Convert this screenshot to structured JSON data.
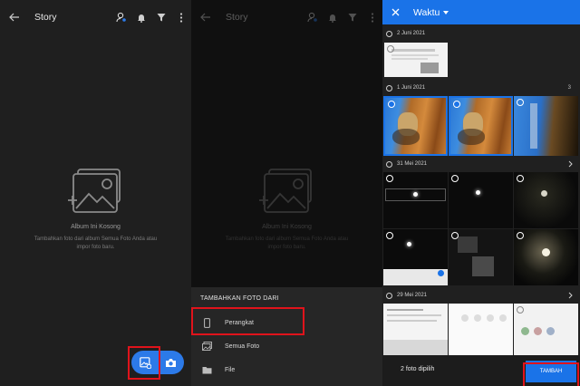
{
  "panel1": {
    "title": "Story",
    "empty_title": "Album Ini Kosong",
    "empty_desc": "Tambahkan foto dari album Semua Foto Anda atau impor foto baru."
  },
  "panel2": {
    "title": "Story",
    "empty_title": "Album Ini Kosong",
    "empty_desc": "Tambahkan foto dari album Semua Foto Anda atau impor foto baru.",
    "sheet_header": "TAMBAHKAN FOTO DARI",
    "items": [
      {
        "label": "Perangkat",
        "icon": "phone-icon"
      },
      {
        "label": "Semua Foto",
        "icon": "photos-icon"
      },
      {
        "label": "File",
        "icon": "folder-icon"
      }
    ]
  },
  "panel3": {
    "title": "Waktu",
    "sections": [
      {
        "date": "2 Juni 2021",
        "count": ""
      },
      {
        "date": "1 Juni 2021",
        "count": "3"
      },
      {
        "date": "31 Mei 2021",
        "count": ""
      },
      {
        "date": "29 Mei 2021",
        "count": ""
      }
    ],
    "selected_text": "2 foto dipilih",
    "add_label": "TAMBAH"
  },
  "colors": {
    "accent": "#1a73e8",
    "highlight": "#e0131b",
    "dark_bg": "#1f1f1f"
  }
}
